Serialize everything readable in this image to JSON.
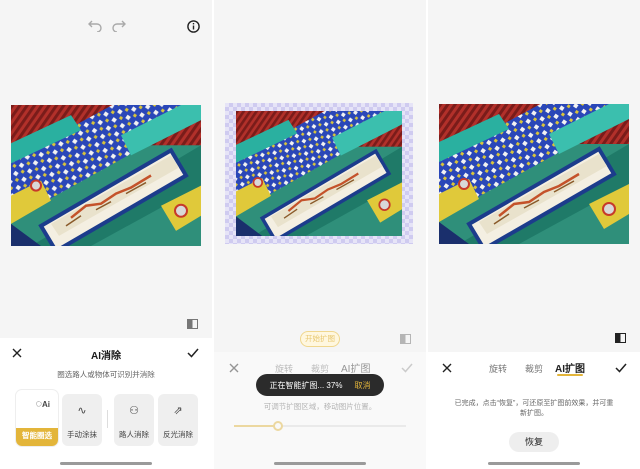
{
  "panel1": {
    "title": "AI消除",
    "hint": "圈选路人或物体可识别并消除",
    "tools": [
      {
        "label": "智能圈选",
        "icon": "ai-circle-icon",
        "active": true
      },
      {
        "label": "手动涂抹",
        "icon": "brush-icon",
        "active": false
      },
      {
        "label": "路人消除",
        "icon": "people-icon",
        "active": false
      },
      {
        "label": "反光消除",
        "icon": "reflection-icon",
        "active": false
      }
    ]
  },
  "panel2": {
    "start_button": "开始扩图",
    "tabs": [
      "旋转",
      "裁剪",
      "AI扩图"
    ],
    "toast_text": "正在智能扩图... 37%",
    "toast_cancel": "取消",
    "hint": "可调节扩图区域，移动图片位置。",
    "progress_percent": 37
  },
  "panel3": {
    "tabs": [
      "旋转",
      "裁剪",
      "AI扩图"
    ],
    "done_hint_line1": "已完成，点击“恢复”，可还原至扩图前效果，并可重",
    "done_hint_line2": "新扩图。",
    "restore_button": "恢复"
  },
  "colors": {
    "accent": "#e3b53a",
    "toast_bg": "#2b2b2b"
  }
}
